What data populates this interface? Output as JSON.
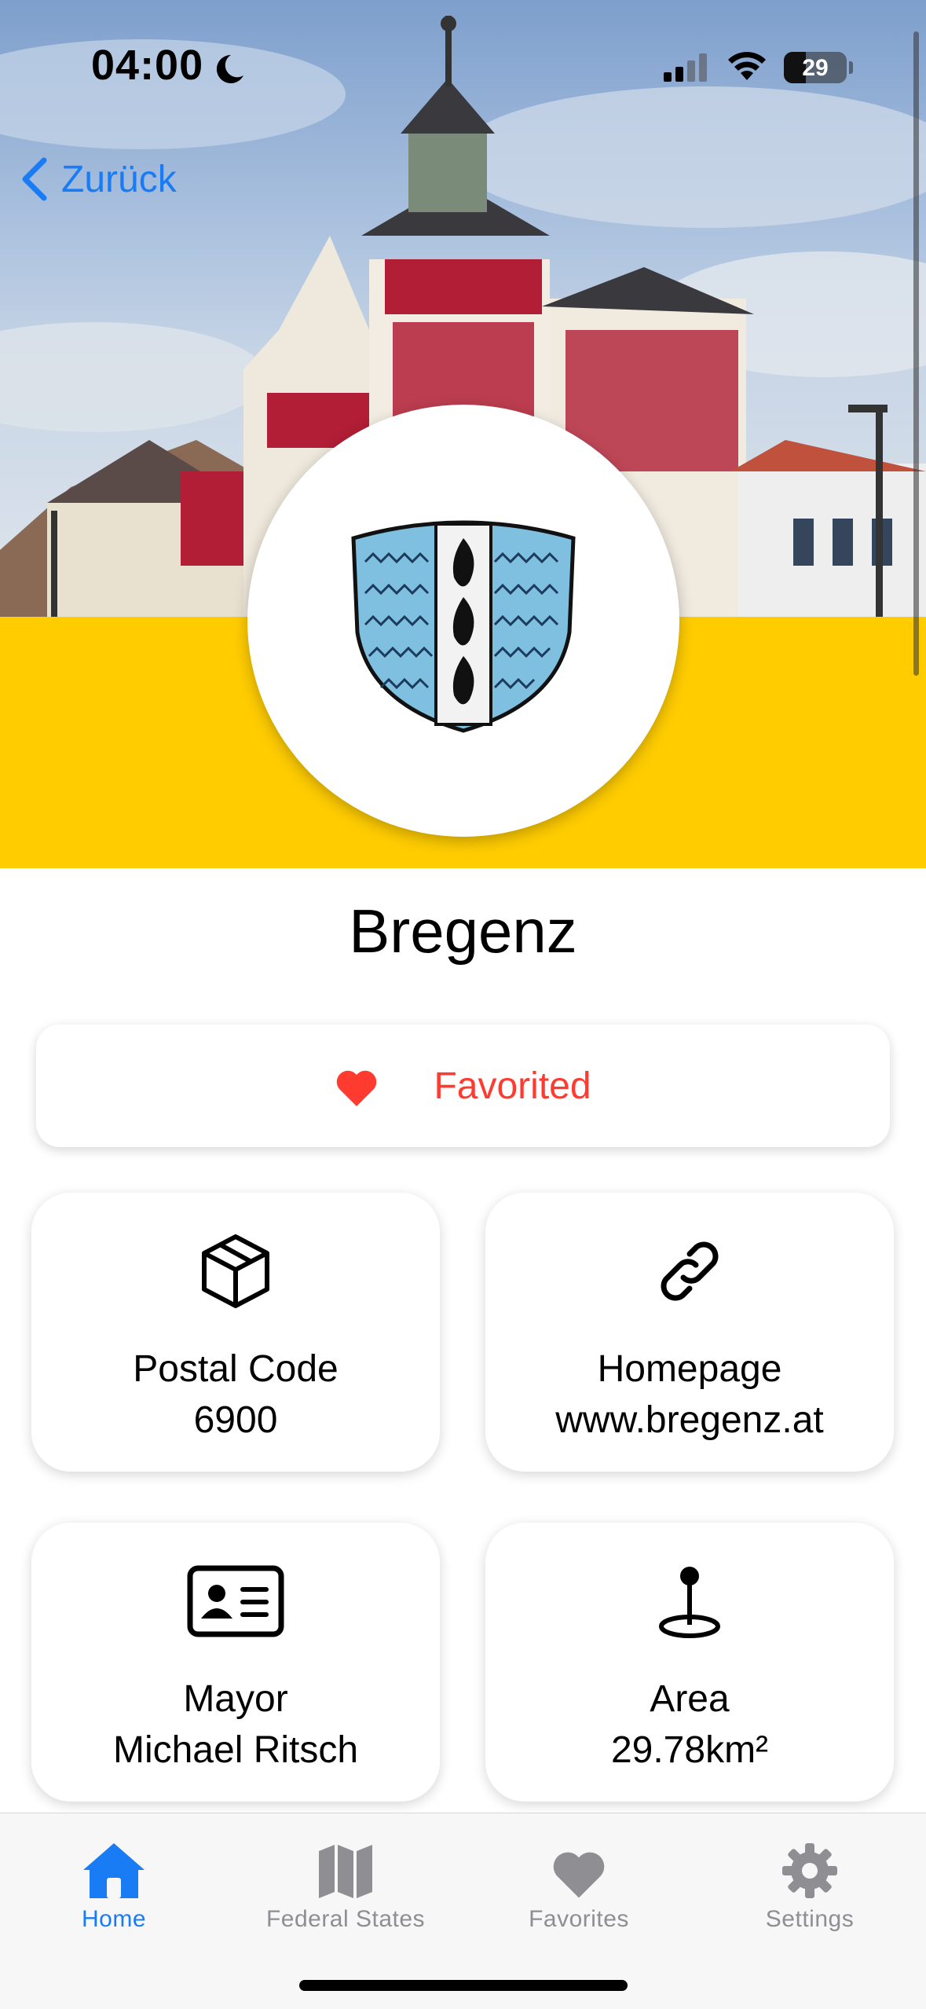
{
  "status_bar": {
    "time": "04:00",
    "battery": "29"
  },
  "nav": {
    "back_label": "Zurück"
  },
  "municipality": {
    "name": "Bregenz"
  },
  "favorite": {
    "label": "Favorited",
    "color": "#ff3b30"
  },
  "cards": [
    {
      "icon": "package-icon",
      "label": "Postal Code",
      "value": "6900"
    },
    {
      "icon": "link-icon",
      "label": "Homepage",
      "value": "www.bregenz.at"
    },
    {
      "icon": "id-card-icon",
      "label": "Mayor",
      "value": "Michael Ritsch"
    },
    {
      "icon": "map-pin-icon",
      "label": "Area",
      "value": "29.78km²"
    }
  ],
  "tabs": [
    {
      "icon": "house-icon",
      "label": "Home",
      "active": true
    },
    {
      "icon": "map-icon",
      "label": "Federal States",
      "active": false
    },
    {
      "icon": "heart-icon",
      "label": "Favorites",
      "active": false
    },
    {
      "icon": "gear-icon",
      "label": "Settings",
      "active": false
    }
  ],
  "colors": {
    "accent": "#1a7cf5",
    "band": "#ffcc00",
    "crest_blue": "#7fc0e0"
  }
}
